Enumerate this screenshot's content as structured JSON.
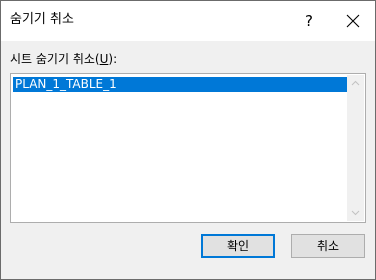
{
  "dialog": {
    "title": "숨기기 취소",
    "help_label": "?",
    "close_icon": "close-icon"
  },
  "sheets": {
    "label_prefix": "시트 숨기기 취소(",
    "label_mnemonic": "U",
    "label_suffix": "):",
    "items": [
      "PLAN_1_TABLE_1"
    ],
    "selected_index": 0
  },
  "buttons": {
    "ok_label": "확인",
    "cancel_label": "취소"
  },
  "colors": {
    "selection": "#0078d7",
    "dialog_background": "#f0f0f0",
    "titlebar_background": "#ffffff"
  }
}
